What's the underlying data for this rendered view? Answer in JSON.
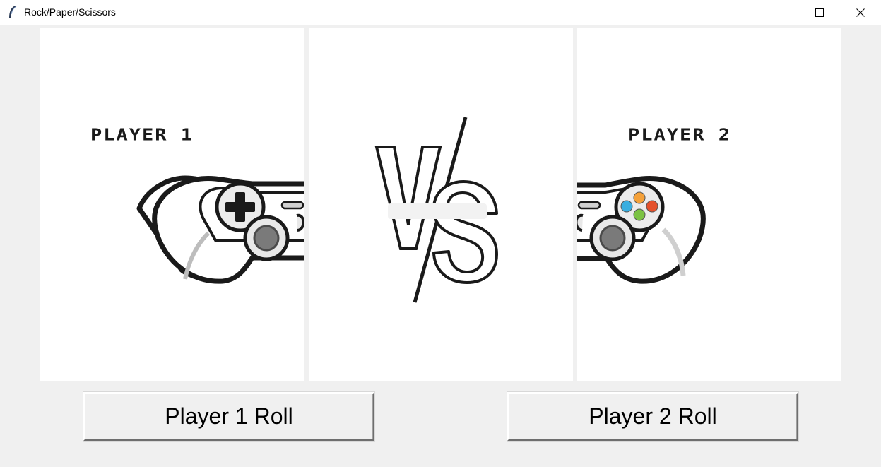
{
  "window": {
    "title": "Rock/Paper/Scissors",
    "icon": "feather-icon"
  },
  "panels": {
    "player1": {
      "label": "PLAYER 1",
      "icon": "gamepad-left-icon"
    },
    "versus": {
      "icon": "versus-icon"
    },
    "player2": {
      "label": "PLAYER 2",
      "icon": "gamepad-right-icon"
    }
  },
  "buttons": {
    "player1_roll": "Player 1 Roll",
    "player2_roll": "Player 2 Roll"
  },
  "colors": {
    "background": "#f0f0f0",
    "panel": "#ffffff",
    "button_a": "#f4a13a",
    "button_b": "#e4512c",
    "button_c": "#39aee0",
    "button_d": "#7cc243"
  }
}
